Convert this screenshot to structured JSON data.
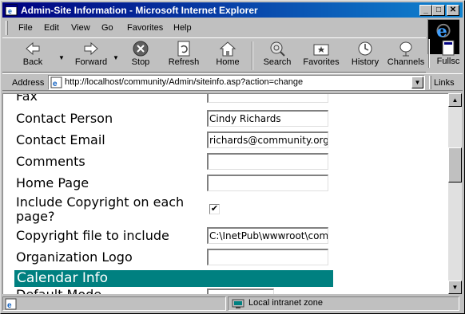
{
  "window": {
    "title": "Admin-Site Information - Microsoft Internet Explorer"
  },
  "title_buttons": {
    "minimize": "_",
    "maximize": "□",
    "close": "✕"
  },
  "menu": [
    "File",
    "Edit",
    "View",
    "Go",
    "Favorites",
    "Help"
  ],
  "toolbar": {
    "back": "Back",
    "forward": "Forward",
    "stop": "Stop",
    "refresh": "Refresh",
    "home": "Home",
    "search": "Search",
    "favorites": "Favorites",
    "history": "History",
    "channels": "Channels",
    "fullscreen": "Fullsc"
  },
  "address": {
    "label": "Address",
    "url": "http://localhost/community/Admin/siteinfo.asp?action=change"
  },
  "links_label": "Links",
  "form": {
    "rows": [
      {
        "label": "Fax",
        "value": ""
      },
      {
        "label": "Contact Person",
        "value": "Cindy Richards"
      },
      {
        "label": "Contact Email",
        "value": "richards@community.org"
      },
      {
        "label": "Comments",
        "value": ""
      },
      {
        "label": "Home Page",
        "value": ""
      },
      {
        "label": "Include Copyright on each",
        "label2": "page?",
        "checked": "✔"
      },
      {
        "label": "Copyright file to include",
        "value": "C:\\InetPub\\wwwroot\\comm"
      },
      {
        "label": "Organization Logo",
        "value": ""
      }
    ],
    "section_header": "Calendar Info",
    "next_label": "Default Mode"
  },
  "status": {
    "zone": "Local intranet zone"
  },
  "colors": {
    "title_start": "#000080",
    "title_end": "#1084d0",
    "section_bar": "#008080"
  }
}
